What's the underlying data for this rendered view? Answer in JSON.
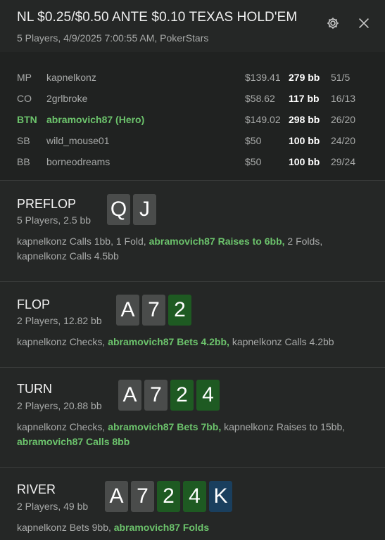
{
  "header": {
    "title": "NL $0.25/$0.50 ANTE $0.10 TEXAS HOLD'EM",
    "subtitle": "5 Players, 4/9/2025 7:00:55 AM, PokerStars",
    "settings_icon": "gear-icon",
    "close_icon": "close-icon"
  },
  "players": [
    {
      "pos": "MP",
      "name": "kapnelkonz",
      "stack": "$139.41",
      "bb": "279 bb",
      "stat": "51/5",
      "hero": false
    },
    {
      "pos": "CO",
      "name": "2grlbroke",
      "stack": "$58.62",
      "bb": "117 bb",
      "stat": "16/13",
      "hero": false
    },
    {
      "pos": "BTN",
      "name": "abramovich87 (Hero)",
      "stack": "$149.02",
      "bb": "298 bb",
      "stat": "26/20",
      "hero": true
    },
    {
      "pos": "SB",
      "name": "wild_mouse01",
      "stack": "$50",
      "bb": "100 bb",
      "stat": "24/20",
      "hero": false
    },
    {
      "pos": "BB",
      "name": "borneodreams",
      "stack": "$50",
      "bb": "100 bb",
      "stat": "29/24",
      "hero": false
    }
  ],
  "streets": {
    "preflop": {
      "name": "PREFLOP",
      "info": "5 Players, 2.5 bb",
      "cards": [
        "Q",
        "J"
      ],
      "a1": "kapnelkonz Calls 1bb, 1 Fold, ",
      "a2": "abramovich87 Raises to 6bb,",
      "a3": " 2 Folds, kapnelkonz Calls 4.5bb"
    },
    "flop": {
      "name": "FLOP",
      "info": "2 Players, 12.82 bb",
      "cards": [
        "A",
        "7",
        "2"
      ],
      "a1": "kapnelkonz Checks, ",
      "a2": "abramovich87 Bets 4.2bb,",
      "a3": " kapnelkonz Calls 4.2bb"
    },
    "turn": {
      "name": "TURN",
      "info": "2 Players, 20.88 bb",
      "cards": [
        "A",
        "7",
        "2",
        "4"
      ],
      "a1": "kapnelkonz Checks, ",
      "a2": "abramovich87 Bets 7bb,",
      "a3": " kapnelkonz Raises to 15bb, ",
      "a4": "abramovich87 Calls 8bb"
    },
    "river": {
      "name": "RIVER",
      "info": "2 Players, 49 bb",
      "cards": [
        "A",
        "7",
        "2",
        "4",
        "K"
      ],
      "a1": "kapnelkonz Bets 9bb, ",
      "a2": "abramovich87 Folds"
    }
  },
  "colors": {
    "background": "#252726",
    "hero_green": "#6cc36c",
    "card_gray": "#4a4c4b",
    "card_green": "#1e5a22",
    "card_blue": "#1a3f5e"
  }
}
